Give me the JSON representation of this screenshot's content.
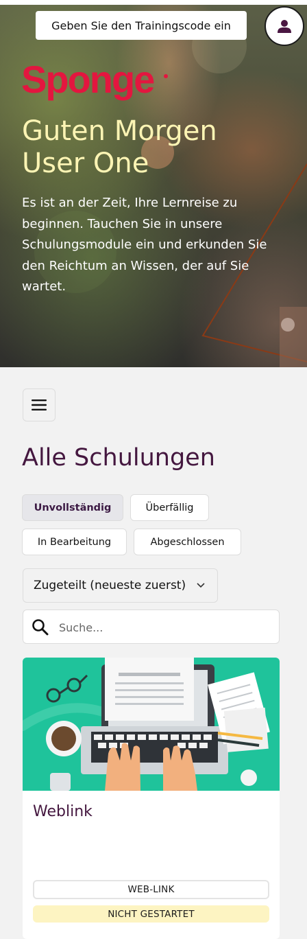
{
  "header": {
    "training_code_button": "Geben Sie den Trainingscode ein",
    "brand": "Sponge",
    "greeting_line1": "Guten Morgen",
    "greeting_line2": "User One",
    "intro": "Es ist an der Zeit, Ihre Lernreise zu beginnen. Tauchen Sie in unsere Schulungsmodule ein und erkunden Sie den Reichtum an Wissen, der auf Sie wartet."
  },
  "main": {
    "title": "Alle Schulungen",
    "filters": [
      {
        "label": "Unvollständig",
        "active": true
      },
      {
        "label": "Überfällig",
        "active": false
      },
      {
        "label": "In Bearbeitung",
        "active": false
      },
      {
        "label": "Abgeschlossen",
        "active": false
      }
    ],
    "sort": {
      "selected": "Zugeteilt (neueste zuerst)"
    },
    "search": {
      "placeholder": "Suche..."
    },
    "cards": [
      {
        "title": "Weblink",
        "type_badge": "WEB-LINK",
        "status_badge": "NICHT GESTARTET"
      }
    ]
  },
  "colors": {
    "brand_red": "#e3163f",
    "title_purple": "#44173f",
    "greeting_yellow": "#fcf4b4",
    "card_image_green": "#1fc39b",
    "status_yellow": "#fdf4c2"
  },
  "icons": [
    "user-icon",
    "hamburger-menu-icon",
    "chevron-down-icon",
    "search-icon"
  ]
}
